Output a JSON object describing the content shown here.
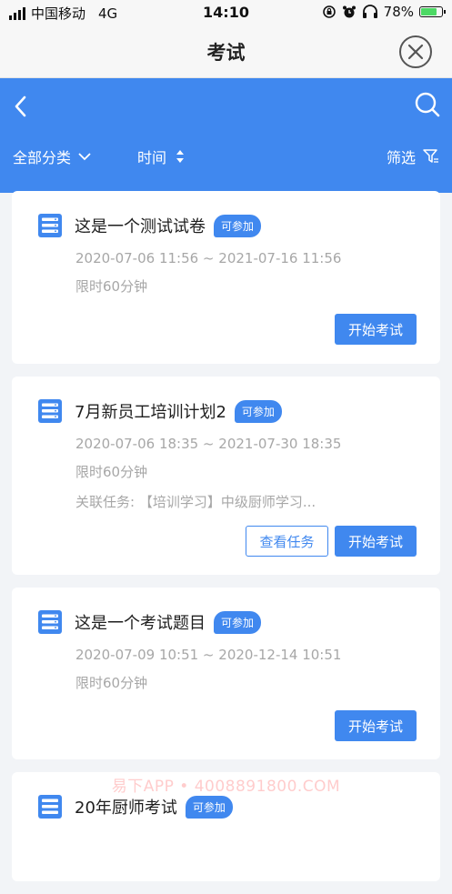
{
  "status": {
    "carrier": "中国移动",
    "network": "4G",
    "time": "14:10",
    "battery": "78%"
  },
  "nav": {
    "title": "考试"
  },
  "filters": {
    "category": "全部分类",
    "time": "时间",
    "screen": "筛选"
  },
  "exams": [
    {
      "title": "这是一个测试试卷",
      "badge": "可参加",
      "period": "2020-07-06 11:56 ~ 2021-07-16 11:56",
      "limit": "限时60分钟",
      "start": "开始考试"
    },
    {
      "title": "7月新员工培训计划2",
      "badge": "可参加",
      "period": "2020-07-06 18:35 ~ 2021-07-30 18:35",
      "limit": "限时60分钟",
      "related": "关联任务: 【培训学习】中级厨师学习...",
      "view": "查看任务",
      "start": "开始考试"
    },
    {
      "title": "这是一个考试题目",
      "badge": "可参加",
      "period": "2020-07-09 10:51 ~ 2020-12-14 10:51",
      "limit": "限时60分钟",
      "start": "开始考试"
    },
    {
      "title": "20年厨师考试",
      "badge": "可参加"
    }
  ],
  "watermark": "易下APP • 4008891800.COM",
  "colors": {
    "accent": "#4088ef",
    "muted": "#a7a7a7",
    "battery": "#4cd964"
  }
}
